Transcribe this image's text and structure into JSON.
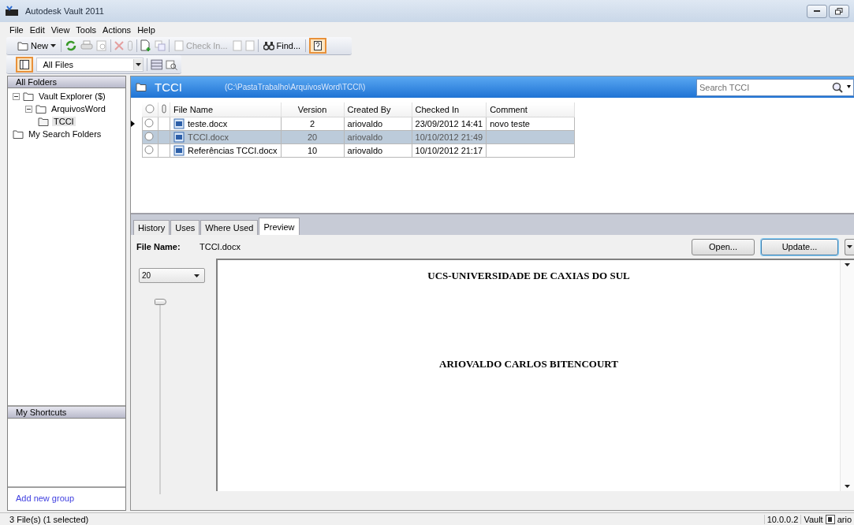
{
  "window": {
    "title": "Autodesk Vault 2011"
  },
  "menu": [
    "File",
    "Edit",
    "View",
    "Tools",
    "Actions",
    "Help"
  ],
  "toolbar": {
    "new_label": "New",
    "check_in": {
      "label": "Check In...",
      "disabled": true
    },
    "find_label": "Find..."
  },
  "view_selector": {
    "value": "All Files"
  },
  "folders": {
    "header": "All Folders",
    "tree": [
      {
        "label": "Vault Explorer ($)",
        "expanded": true,
        "selected": false,
        "children": [
          {
            "label": "ArquivosWord",
            "expanded": true,
            "selected": false,
            "children": [
              {
                "label": "TCCI",
                "selected": true
              }
            ]
          }
        ]
      },
      {
        "label": "My Search Folders",
        "selected": false
      }
    ]
  },
  "shortcuts": {
    "header": "My Shortcuts",
    "add_link": "Add new group"
  },
  "folder_header": {
    "title": "TCCI",
    "path": "(C:\\PastaTrabalho\\ArquivosWord\\TCCI\\)",
    "search_placeholder": "Search TCCI"
  },
  "table": {
    "columns": [
      "File Name",
      "Version",
      "Created By",
      "Checked In",
      "Comment"
    ],
    "rows": [
      {
        "current": true,
        "selected": false,
        "cells": [
          "teste.docx",
          "2",
          "ariovaldo",
          "23/09/2012 14:41",
          "novo teste"
        ]
      },
      {
        "current": false,
        "selected": true,
        "cells": [
          "TCCI.docx",
          "20",
          "ariovaldo",
          "10/10/2012 21:49",
          ""
        ]
      },
      {
        "current": false,
        "selected": false,
        "cells": [
          "Referências TCCI.docx",
          "10",
          "ariovaldo",
          "10/10/2012 21:17",
          ""
        ]
      }
    ]
  },
  "tabs": [
    {
      "label": "History",
      "selected": false
    },
    {
      "label": "Uses",
      "selected": false
    },
    {
      "label": "Where Used",
      "selected": false
    },
    {
      "label": "Preview",
      "selected": true
    }
  ],
  "file_name": {
    "label": "File Name:",
    "value": "TCCI.docx"
  },
  "buttons": [
    "Open...",
    "Update..."
  ],
  "zoom": {
    "value": "20",
    "level": 1
  },
  "document": [
    "UCS-UNIVERSIDADE DE CAXIAS DO SUL",
    "ARIOVALDO CARLOS BITENCOURT"
  ],
  "status_bar": {
    "text": "3 File(s) (1 selected)",
    "server": "10.0.0.2",
    "vault": "Vault",
    "user": "ario"
  }
}
